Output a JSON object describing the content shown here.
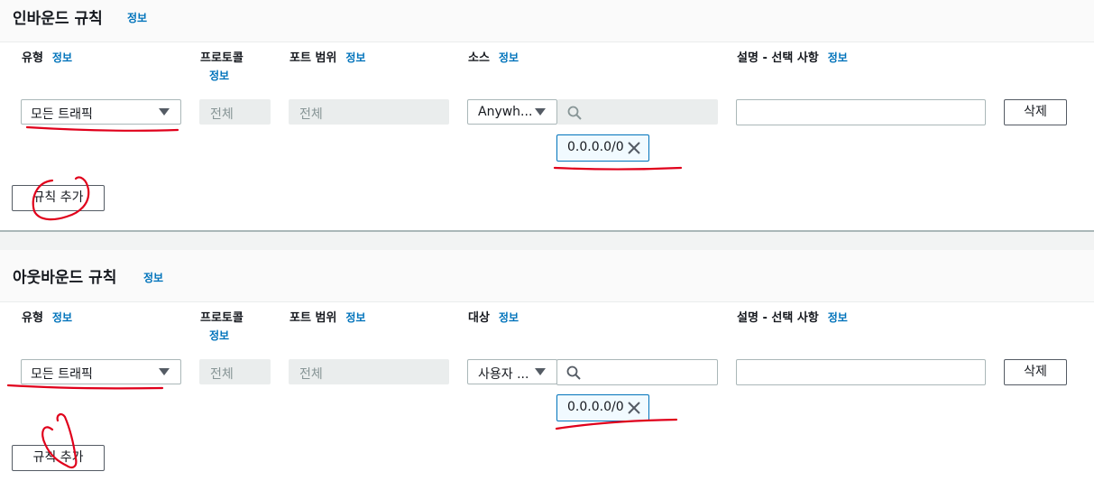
{
  "info_label": "정보",
  "inbound": {
    "title": "인바운드 규칙",
    "columns": {
      "type": "유형",
      "protocol": "프로토콜",
      "port_range": "포트 범위",
      "source": "소스",
      "description": "설명 - 선택 사항"
    },
    "rule": {
      "type_value": "모든 트래픽",
      "protocol_value": "전체",
      "port_value": "전체",
      "source_select": "Anywh...",
      "source_search": "",
      "cidr_token": "0.0.0.0/0",
      "description_value": "",
      "delete_label": "삭제"
    },
    "add_rule_label": "규칙 추가"
  },
  "outbound": {
    "title": "아웃바운드 규칙",
    "columns": {
      "type": "유형",
      "protocol": "프로토콜",
      "port_range": "포트 범위",
      "destination": "대상",
      "description": "설명 - 선택 사항"
    },
    "rule": {
      "type_value": "모든 트래픽",
      "protocol_value": "전체",
      "port_value": "전체",
      "dest_select": "사용자 ...",
      "dest_search": "",
      "cidr_token": "0.0.0.0/0",
      "description_value": "",
      "delete_label": "삭제"
    },
    "add_rule_label": "규칙 추가"
  },
  "colors": {
    "link": "#0073bb",
    "annotation": "#e0001b",
    "token_border": "#0073bb"
  },
  "icons": [
    "caret-down-icon",
    "search-icon",
    "close-icon"
  ]
}
